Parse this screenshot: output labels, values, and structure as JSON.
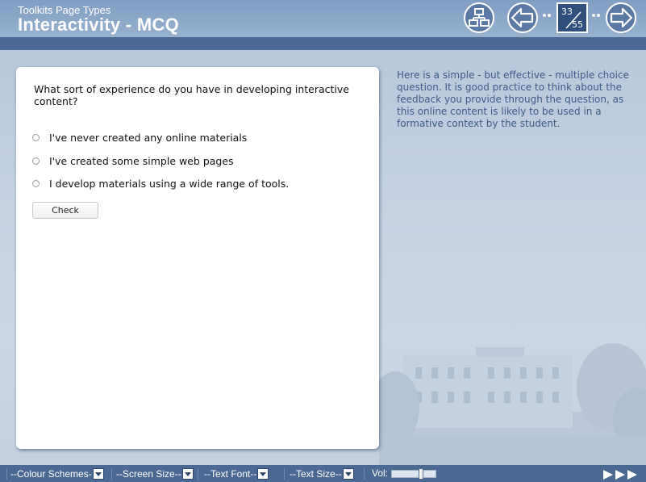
{
  "header": {
    "subtitle": "Toolkits Page Types",
    "title": "Interactivity - MCQ"
  },
  "nav": {
    "sitemap_icon": "sitemap-icon",
    "prev_icon": "arrow-left-icon",
    "next_icon": "arrow-right-icon",
    "current_page": "33",
    "total_pages": "55"
  },
  "question": {
    "text": "What sort of experience do you have in developing interactive content?",
    "options": [
      "I've never created any online materials",
      "I've created some simple web pages",
      "I develop materials using a wide range of tools."
    ],
    "check_label": "Check"
  },
  "side_note": "Here is a simple - but effective - multiple choice question. It is good practice to think about the feedback you provide through the question, as this online content is likely to be used in a  formative context by the student.",
  "footer": {
    "colour_schemes": "--Colour Schemes-",
    "screen_size": "--Screen Size--",
    "text_font": "--Text Font--",
    "text_size": "--Text Size--",
    "vol_label": "Vol:",
    "volume": 0.68,
    "play_icons": [
      "play-icon",
      "play-icon",
      "play-icon"
    ]
  },
  "colors": {
    "header_bg": "#8aa7c9",
    "dark_bar": "#4a6a94",
    "side_text": "#3e5a86"
  }
}
